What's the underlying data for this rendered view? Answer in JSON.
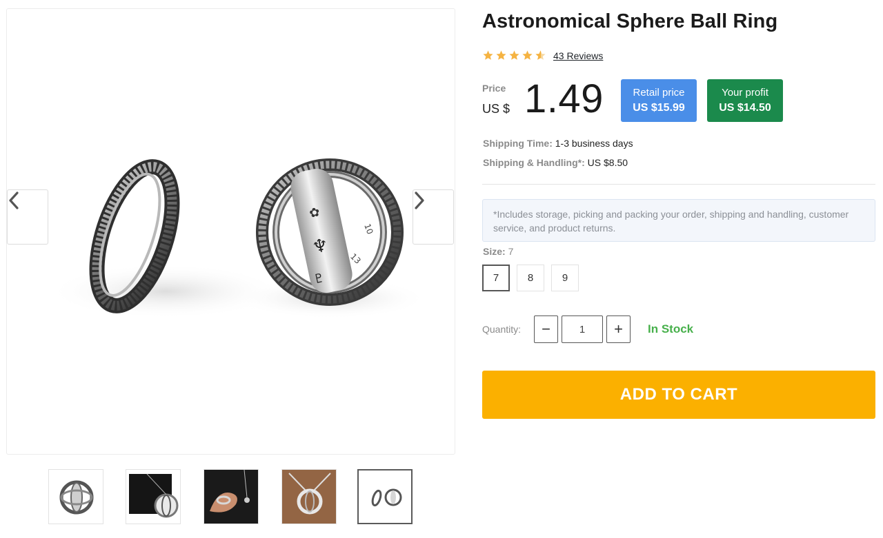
{
  "product": {
    "title": "Astronomical Sphere Ball Ring",
    "rating": 4.5,
    "reviews_label": "43 Reviews",
    "price_label": "Price",
    "currency": "US $",
    "price": "1.49",
    "retail": {
      "label": "Retail price",
      "value": "US $15.99"
    },
    "profit": {
      "label": "Your profit",
      "value": "US $14.50"
    },
    "shipping_time": {
      "label": "Shipping Time:",
      "value": "1-3 business days"
    },
    "shipping_handling": {
      "label": "Shipping & Handling*:",
      "value": "US $8.50"
    },
    "note": "*Includes storage, picking and packing your order, shipping and handling, customer service, and product returns.",
    "size": {
      "label": "Size:",
      "selected": "7",
      "options": [
        "7",
        "8",
        "9"
      ]
    },
    "quantity": {
      "label": "Quantity:",
      "value": "1",
      "minus": "−",
      "plus": "+"
    },
    "stock": "In Stock",
    "add_to_cart": "ADD TO CART"
  },
  "colors": {
    "star": "#f5b342",
    "retail_badge": "#4a8ee8",
    "profit_badge": "#1b8a4c",
    "in_stock": "#47b04b",
    "add_to_cart": "#fbb000"
  },
  "gallery": {
    "thumbnails": [
      "ring-thumb",
      "necklace-model-thumb",
      "hand-ring-thumb",
      "pendant-wood-thumb",
      "two-rings-thumb"
    ],
    "active_thumbnail": 4
  }
}
